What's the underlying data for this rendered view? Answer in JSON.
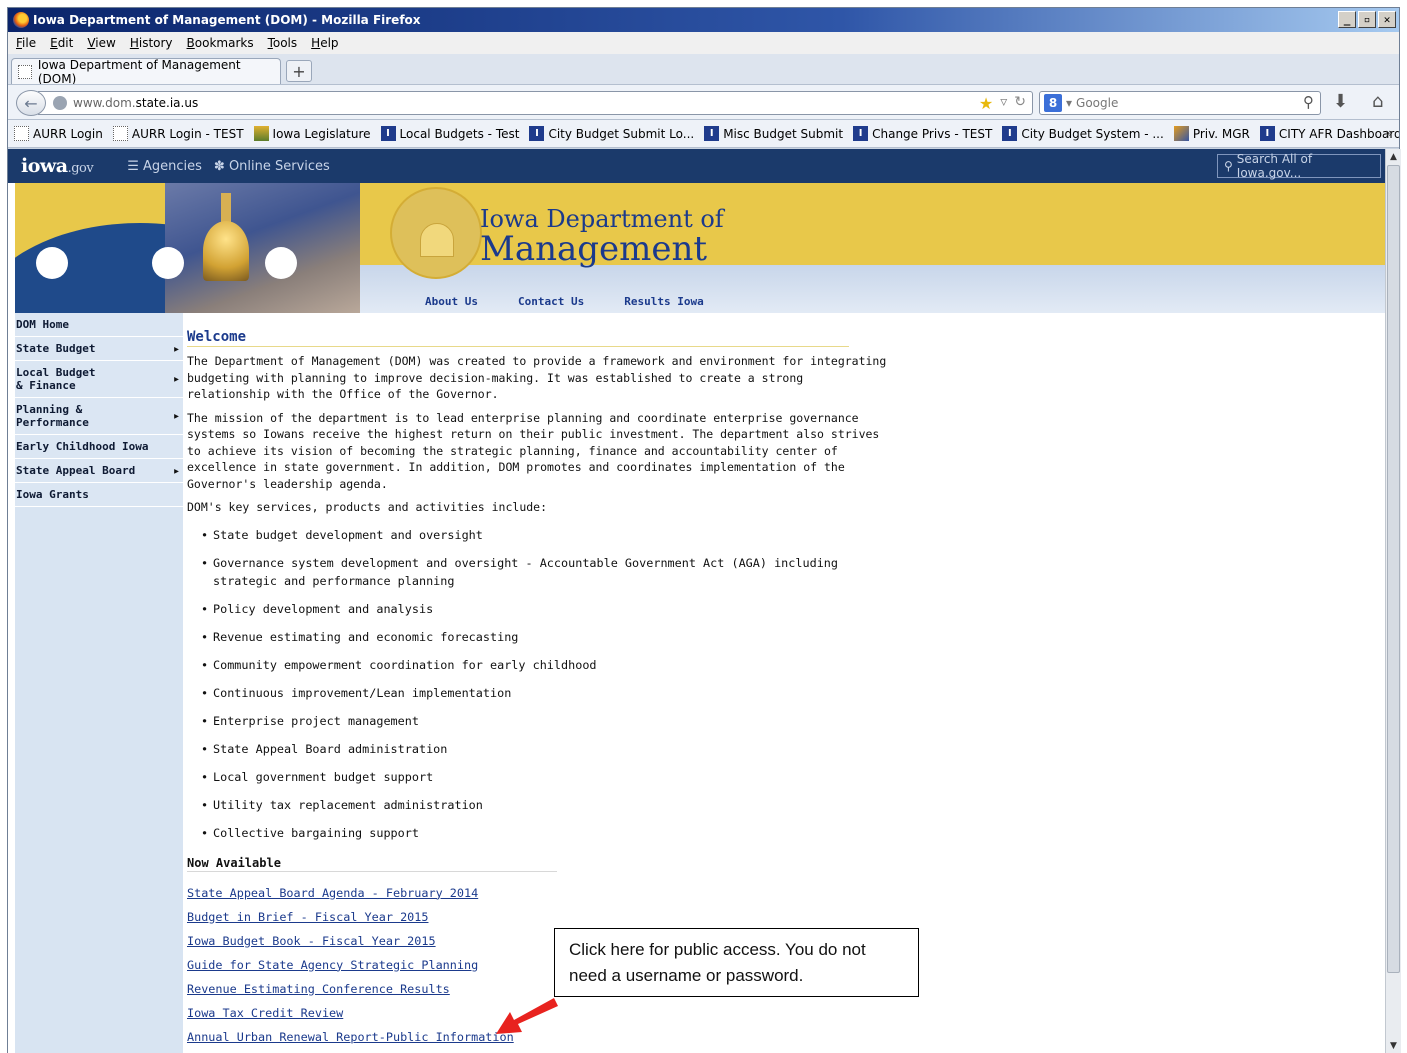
{
  "window": {
    "title": "Iowa Department of Management (DOM) - Mozilla Firefox",
    "controls": [
      "_",
      "▫",
      "✕"
    ]
  },
  "menu": [
    "File",
    "Edit",
    "View",
    "History",
    "Bookmarks",
    "Tools",
    "Help"
  ],
  "tab": {
    "label": "Iowa Department of Management (DOM)",
    "new_tab": "+"
  },
  "nav": {
    "url_prefix": "www.dom.",
    "url_host": "state.ia.us",
    "search_placeholder": "Google",
    "search_engine": "8"
  },
  "bookmarks": [
    {
      "label": "AURR Login",
      "icon": "blank"
    },
    {
      "label": "AURR Login - TEST",
      "icon": "blank"
    },
    {
      "label": "Iowa Legislature",
      "icon": "leg"
    },
    {
      "label": "Local Budgets - Test",
      "icon": "iowa"
    },
    {
      "label": "City Budget Submit Lo...",
      "icon": "iowa"
    },
    {
      "label": "Misc Budget Submit",
      "icon": "iowa"
    },
    {
      "label": "Change Privs - TEST",
      "icon": "iowa"
    },
    {
      "label": "City Budget System - ...",
      "icon": "iowa"
    },
    {
      "label": "Priv. MGR",
      "icon": "priv"
    },
    {
      "label": "CITY AFR Dashboard",
      "icon": "iowa"
    }
  ],
  "govbar": {
    "logo_main": "iowa",
    "logo_suffix": ".gov",
    "agencies": "Agencies",
    "online_services": "Online Services",
    "search_placeholder": "Search All of Iowa.gov..."
  },
  "banner": {
    "title_line1": "Iowa Department of",
    "title_line2": "Management",
    "links": [
      "About Us",
      "Contact Us",
      "Results Iowa"
    ]
  },
  "sidenav": [
    {
      "label": "DOM Home",
      "has_arrow": false
    },
    {
      "label": "State Budget",
      "has_arrow": true
    },
    {
      "label": "Local Budget\n& Finance",
      "has_arrow": true
    },
    {
      "label": "Planning &\nPerformance",
      "has_arrow": true
    },
    {
      "label": "Early Childhood Iowa",
      "has_arrow": false
    },
    {
      "label": "State Appeal Board",
      "has_arrow": true
    },
    {
      "label": "Iowa Grants",
      "has_arrow": false
    }
  ],
  "main": {
    "heading": "Welcome",
    "para1": "The Department of Management (DOM) was created to provide a framework and environment for integrating budgeting with planning to improve decision-making. It was established to create a strong relationship with the Office of the Governor.",
    "para2": "The mission of the department is to lead enterprise planning and coordinate enterprise governance systems so Iowans receive the highest return on their public investment. The department also strives to achieve its vision of becoming the strategic planning, finance and accountability center of excellence in state government. In addition, DOM promotes and coordinates implementation of the Governor's leadership agenda.",
    "para3": "DOM's key services, products and activities include:",
    "services": [
      "State budget development and oversight",
      "Governance system development and oversight - Accountable Government Act (AGA) including strategic and performance planning",
      "Policy development and analysis",
      "Revenue estimating and economic forecasting",
      "Community empowerment coordination for early childhood",
      "Continuous improvement/Lean implementation",
      "Enterprise project management",
      "State Appeal Board administration",
      "Local government budget support",
      "Utility tax replacement administration",
      "Collective bargaining support"
    ],
    "now_available_heading": "Now Available",
    "now_available": [
      "State Appeal Board Agenda - February 2014",
      "Budget in Brief - Fiscal Year 2015",
      "Iowa Budget Book - Fiscal Year 2015",
      "Guide for State Agency Strategic Planning",
      "Revenue Estimating Conference Results",
      "Iowa Tax Credit Review",
      "Annual Urban Renewal Report-Public Information"
    ]
  },
  "callout": {
    "text": "Click here for public access.  You do not need a username or password.",
    "arrow_color": "#e8231f"
  }
}
